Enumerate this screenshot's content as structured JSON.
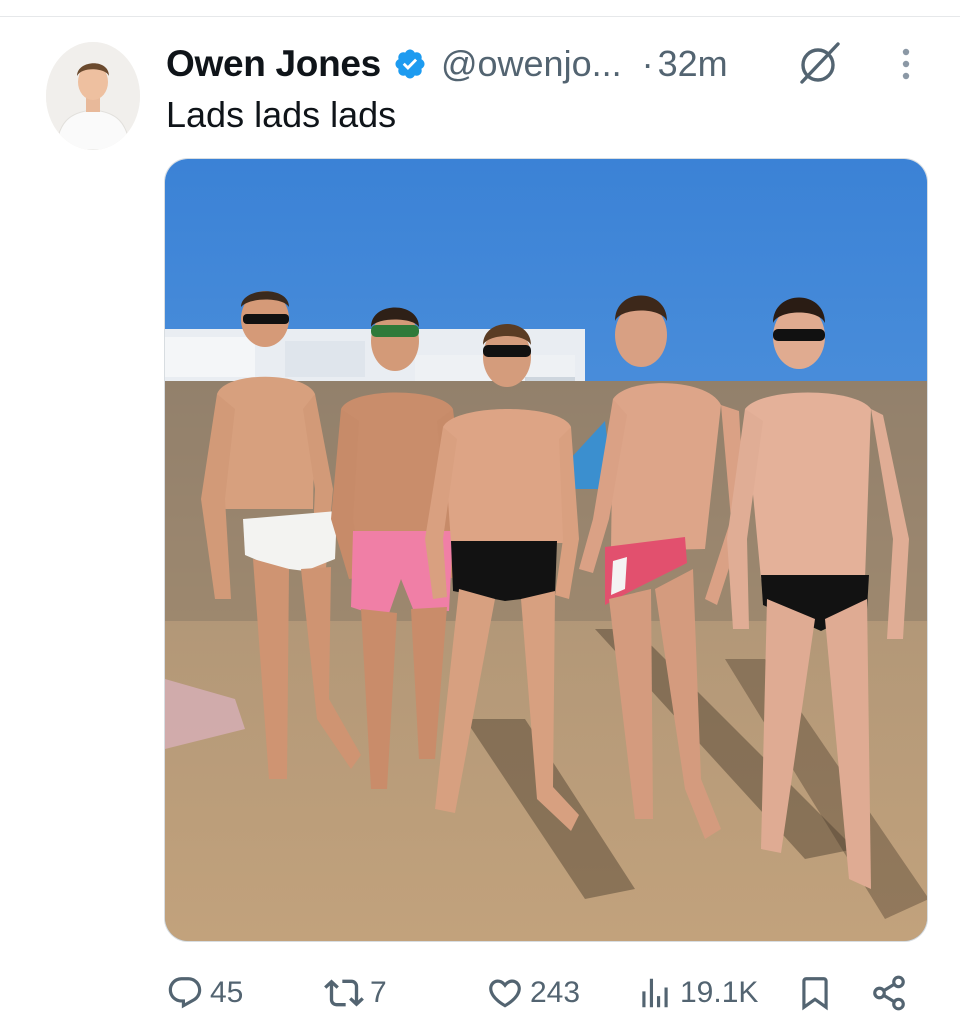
{
  "tweet": {
    "author_name": "Owen Jones",
    "handle": "@owenjo...",
    "separator": "·",
    "time_ago": "32m",
    "text": "Lads lads lads"
  },
  "icons": {
    "verified": "verified-badge-icon",
    "grok": "grok-icon",
    "more": "more-options-icon",
    "reply": "reply-icon",
    "repost": "repost-icon",
    "like": "like-icon",
    "views": "views-icon",
    "bookmark": "bookmark-icon",
    "share": "share-icon"
  },
  "stats": {
    "replies": "45",
    "reposts": "7",
    "likes": "243",
    "views": "19.1K"
  },
  "colors": {
    "text": "#0f1419",
    "secondary": "#536471",
    "verified_blue": "#1d9bf0",
    "sky": "#3f86d8"
  }
}
